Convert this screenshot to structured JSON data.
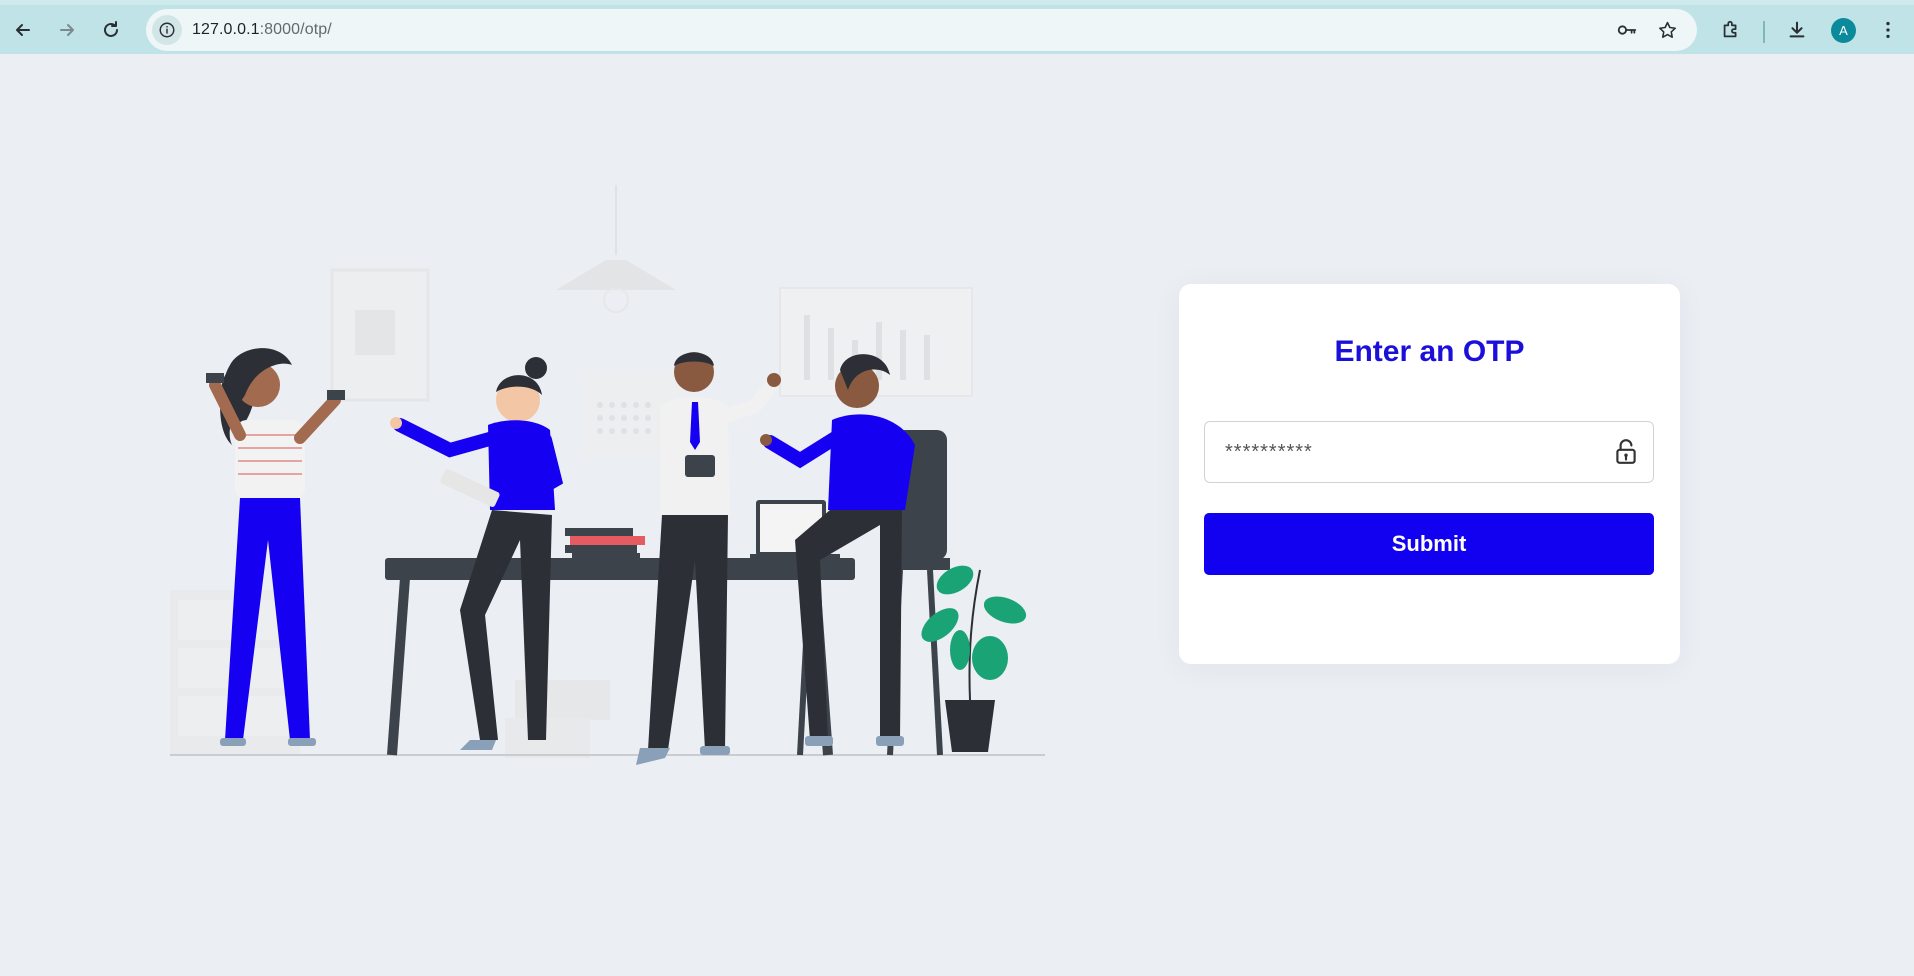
{
  "browser": {
    "url_host": "127.0.0.1",
    "url_rest": ":8000/otp/",
    "profile_initial": "A",
    "icons": [
      "back-icon",
      "forward-icon",
      "reload-icon",
      "site-info-icon",
      "password-key-icon",
      "bookmark-star-icon",
      "extensions-icon",
      "download-icon",
      "menu-icon"
    ]
  },
  "form": {
    "title": "Enter an OTP",
    "otp_placeholder": "**********",
    "submit_label": "Submit"
  },
  "colors": {
    "accent": "#1200f0",
    "title": "#1a10d9",
    "page_bg": "#ebeef3",
    "toolbar_bg": "#bfe3e6"
  }
}
